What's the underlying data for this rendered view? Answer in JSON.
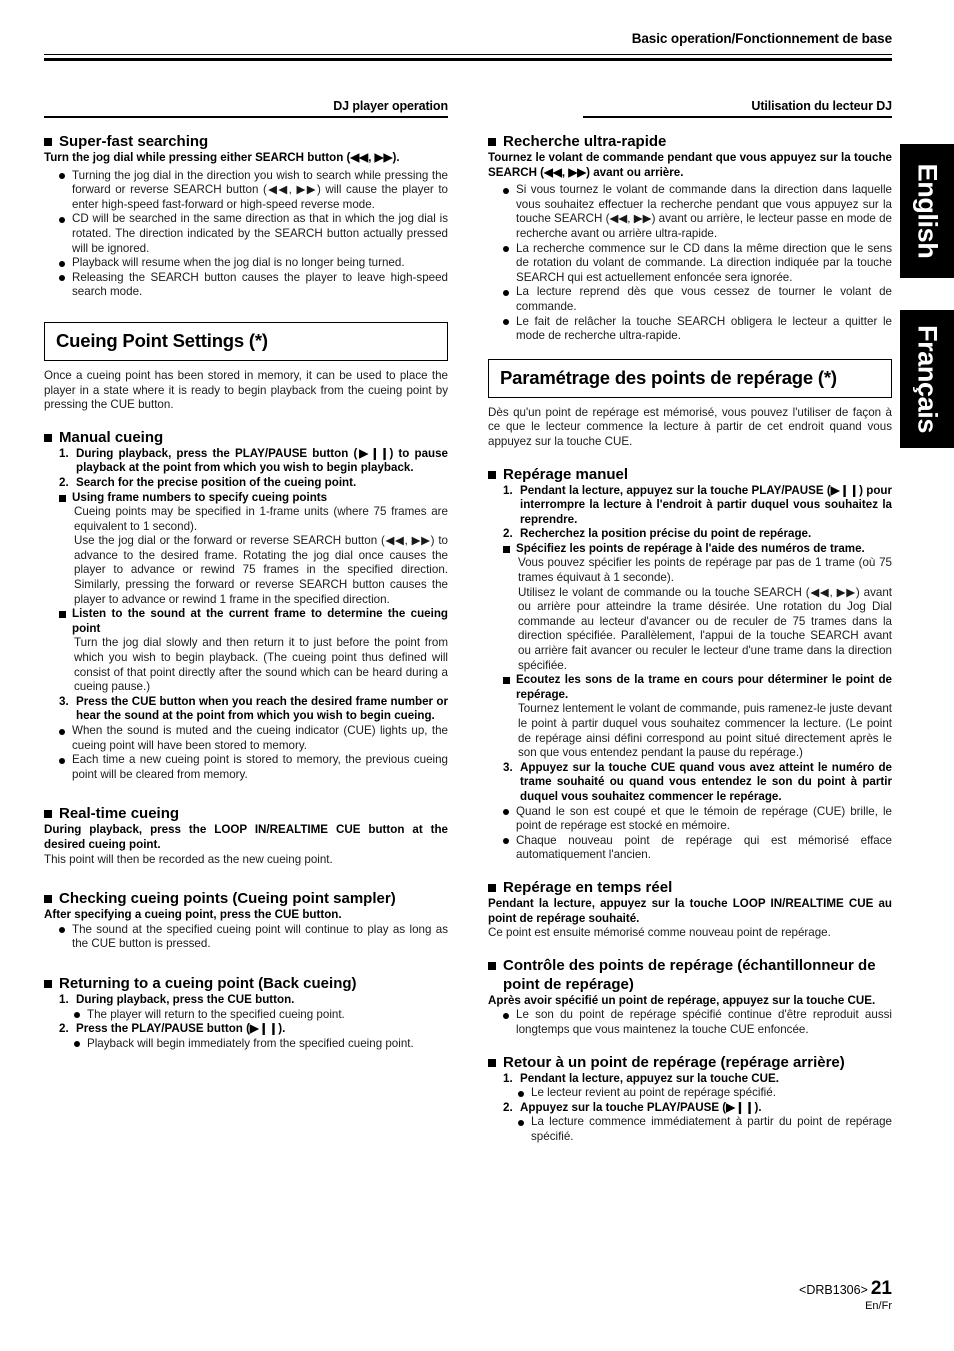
{
  "header": {
    "running_title": "Basic operation/Fonctionnement de base"
  },
  "column_heads": {
    "left": "DJ player operation",
    "right": "Utilisation du lecteur DJ"
  },
  "tabs": {
    "english": "English",
    "french": "Français"
  },
  "footer": {
    "doc_code": "<DRB1306>",
    "page_number": "21",
    "languages": "En/Fr"
  },
  "left_column": {
    "superfast": {
      "heading": "Super-fast searching",
      "lead": "Turn the jog dial while pressing either SEARCH button (◀◀, ▶▶).",
      "bullets": [
        "Turning the jog dial in the direction you wish to search while pressing the forward or reverse SEARCH button (◀◀, ▶▶) will cause the player to enter high-speed fast-forward or high-speed reverse mode.",
        "CD will be searched in the same direction as that in which the jog dial is rotated. The direction indicated by the SEARCH button actually pressed will be ignored.",
        "Playback will resume when the jog dial is no longer being turned.",
        "Releasing the SEARCH button causes the player to leave high-speed search mode."
      ]
    },
    "section_title": "Cueing Point Settings (*)",
    "section_intro": "Once a cueing point has been stored in memory, it can be used to place the player in a state where it is ready to begin playback from the cueing point by pressing the CUE button.",
    "manual_cueing": {
      "heading": "Manual cueing",
      "step1_num": "1.",
      "step1": "During playback, press the PLAY/PAUSE button (▶❙❙) to pause playback at the point from which you wish to begin playback.",
      "step2_num": "2.",
      "step2": "Search for the precise position of the cueing point.",
      "sub1_heading": "Using frame numbers to specify cueing points",
      "sub1_para1": "Cueing points may be specified in 1-frame units (where 75 frames are equivalent to 1 second).",
      "sub1_para2": "Use the jog dial or the forward or reverse SEARCH button (◀◀, ▶▶) to advance to the desired frame. Rotating the jog dial once causes the player to advance or rewind 75 frames in the specified direction. Similarly, pressing the forward or reverse SEARCH button causes the player to advance or rewind 1 frame in the specified direction.",
      "sub2_heading": "Listen to the sound at the current frame to determine the cueing point",
      "sub2_para": "Turn the jog dial slowly and then return it to just before the point from which you wish to begin playback. (The cueing point thus defined will consist of that point directly after the sound which can be heard during a cueing pause.)",
      "step3_num": "3.",
      "step3": "Press the CUE button when you reach the desired frame number or hear the sound at the point from which you wish to begin cueing.",
      "bullets": [
        "When the sound is muted and the cueing indicator (CUE) lights up, the cueing point will have been stored to memory.",
        "Each time a new cueing point is stored to memory, the previous cueing point will be cleared from memory."
      ]
    },
    "realtime_cueing": {
      "heading": "Real-time cueing",
      "lead": "During playback, press the LOOP IN/REALTIME CUE button at the desired cueing point.",
      "para": "This point will then be recorded as the new cueing point."
    },
    "checking_points": {
      "heading": "Checking cueing points (Cueing point sampler)",
      "lead": "After specifying a cueing point, press the CUE button.",
      "bullets": [
        "The sound at the specified cueing point will continue to play as long as the CUE button is pressed."
      ]
    },
    "returning": {
      "heading": "Returning to a cueing point (Back cueing)",
      "step1_num": "1.",
      "step1": "During playback, press the CUE button.",
      "step1_bullet": "The player will return to the specified cueing point.",
      "step2_num": "2.",
      "step2": "Press the PLAY/PAUSE button (▶❙❙).",
      "step2_bullet": "Playback will begin immediately from the specified cueing point."
    }
  },
  "right_column": {
    "recherche": {
      "heading": "Recherche ultra-rapide",
      "lead": "Tournez le volant de commande pendant que vous appuyez sur la touche SEARCH (◀◀, ▶▶) avant ou arrière.",
      "bullets": [
        "Si vous tournez le volant de commande dans la direction dans laquelle vous souhaitez effectuer la recherche pendant que vous appuyez sur la touche SEARCH (◀◀, ▶▶) avant ou arrière, le lecteur passe en mode de recherche avant ou arrière ultra-rapide.",
        "La recherche commence sur le CD dans la même direction que le sens de rotation du volant de commande. La direction indiquée par la touche SEARCH qui est actuellement enfoncée sera ignorée.",
        "La lecture reprend dès que vous cessez de tourner le volant de commande.",
        "Le fait de relâcher la touche SEARCH obligera le lecteur a quitter le mode de recherche ultra-rapide."
      ]
    },
    "section_title": "Paramétrage des points de repérage (*)",
    "section_intro": "Dès qu'un point de repérage est mémorisé, vous pouvez l'utiliser de façon à ce que le lecteur commence la lecture à partir de cet endroit quand vous appuyez sur la touche CUE.",
    "reperage_manuel": {
      "heading": "Repérage manuel",
      "step1_num": "1.",
      "step1": "Pendant la lecture, appuyez sur la touche PLAY/PAUSE (▶❙❙) pour interrompre la lecture à l'endroit à partir duquel vous souhaitez la reprendre.",
      "step2_num": "2.",
      "step2": "Recherchez la position précise du point de repérage.",
      "sub1_heading": "Spécifiez les points de repérage à l'aide des numéros de trame.",
      "sub1_para1": "Vous pouvez spécifier les points de repérage par pas de 1 trame (où 75 trames équivaut à 1 seconde).",
      "sub1_para2": "Utilisez le volant de commande ou la touche SEARCH (◀◀, ▶▶) avant ou arrière pour atteindre la trame désirée. Une rotation du Jog Dial commande au lecteur d'avancer ou de reculer de 75 trames dans la direction spécifiée. Parallèlement, l'appui de la touche SEARCH avant ou arrière fait avancer ou reculer le lecteur d'une trame dans la direction spécifiée.",
      "sub2_heading": "Ecoutez les sons de la trame en cours pour déterminer le point de repérage.",
      "sub2_para": "Tournez lentement le volant de commande, puis ramenez-le juste devant le point à partir duquel vous souhaitez commencer la lecture. (Le point de repérage ainsi défini correspond au point situé directement après le son que vous entendez pendant la pause du repérage.)",
      "step3_num": "3.",
      "step3": "Appuyez sur la touche CUE quand vous avez atteint le numéro de trame souhaité ou quand vous entendez le son du point à partir duquel vous souhaitez commencer le repérage.",
      "bullets": [
        "Quand le son est coupé et que le témoin de repérage (CUE) brille, le point de repérage est stocké en mémoire.",
        "Chaque nouveau point de repérage qui est mémorisé efface automatiquement l'ancien."
      ]
    },
    "temps_reel": {
      "heading": "Repérage en temps réel",
      "lead": "Pendant la lecture, appuyez sur la touche LOOP IN/REALTIME CUE au point de repérage souhaité.",
      "para": "Ce point est ensuite mémorisé comme nouveau point de repérage."
    },
    "controle": {
      "heading": "Contrôle des points de repérage (échantillonneur de point de repérage)",
      "lead": "Après avoir spécifié un point de repérage, appuyez sur la touche CUE.",
      "bullets": [
        "Le son du point de repérage spécifié continue d'être reproduit aussi longtemps que vous maintenez la touche CUE enfoncée."
      ]
    },
    "retour": {
      "heading": "Retour à un point de repérage (repérage arrière)",
      "step1_num": "1.",
      "step1": "Pendant la lecture, appuyez sur la touche CUE.",
      "step1_bullet": "Le lecteur revient au point de repérage spécifié.",
      "step2_num": "2.",
      "step2": "Appuyez sur la touche PLAY/PAUSE (▶❙❙).",
      "step2_bullet": "La lecture commence immédiatement à partir du point de repérage spécifié."
    }
  }
}
